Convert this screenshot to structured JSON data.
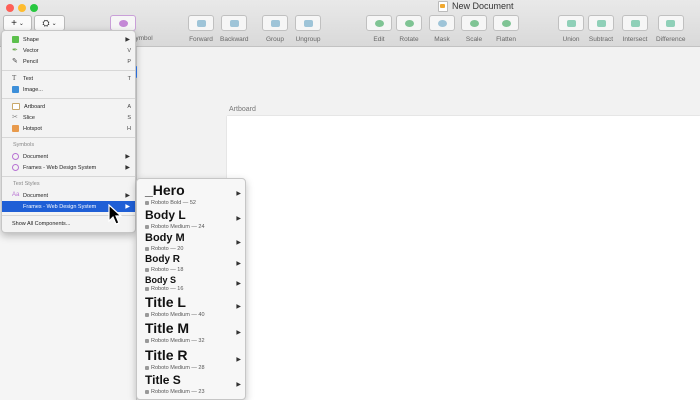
{
  "window": {
    "title": "New Document"
  },
  "toolbar": {
    "add_glyph": "+",
    "symbol_label": "Symbol",
    "tools": [
      {
        "label": "Forward"
      },
      {
        "label": "Backward"
      },
      {
        "label": "Group"
      },
      {
        "label": "Ungroup"
      },
      {
        "label": "Edit"
      },
      {
        "label": "Rotate"
      },
      {
        "label": "Mask"
      },
      {
        "label": "Scale"
      },
      {
        "label": "Flatten"
      },
      {
        "label": "Union"
      },
      {
        "label": "Subtract"
      },
      {
        "label": "Intersect"
      },
      {
        "label": "Difference"
      }
    ]
  },
  "canvas": {
    "artboard_label": "Artboard"
  },
  "insert_menu": {
    "items": [
      {
        "label": "Shape",
        "shortcut": "",
        "submenu": true,
        "icon": "shape-icon",
        "color": "#5cc04c"
      },
      {
        "label": "Vector",
        "shortcut": "V",
        "submenu": false,
        "icon": "vector-pen-icon",
        "color": "#6aa84f"
      },
      {
        "label": "Pencil",
        "shortcut": "P",
        "submenu": false,
        "icon": "pencil-icon",
        "color": "#444444"
      },
      {
        "label": "Text",
        "shortcut": "T",
        "submenu": false,
        "icon": "text-icon",
        "color": "#555555"
      },
      {
        "label": "Image...",
        "shortcut": "",
        "submenu": false,
        "icon": "image-icon",
        "color": "#3d8fd9"
      },
      {
        "label": "Artboard",
        "shortcut": "A",
        "submenu": false,
        "icon": "artboard-icon",
        "color": "#c9a86a"
      },
      {
        "label": "Slice",
        "shortcut": "S",
        "submenu": false,
        "icon": "slice-icon",
        "color": "#888888"
      },
      {
        "label": "Hotspot",
        "shortcut": "H",
        "submenu": false,
        "icon": "hotspot-icon",
        "color": "#e89a4c"
      }
    ],
    "symbols_header": "Symbols",
    "symbols": [
      {
        "label": "Document",
        "submenu": true
      },
      {
        "label": "Frames - Web Design System",
        "submenu": true
      }
    ],
    "text_styles_header": "Text Styles",
    "text_styles": [
      {
        "label": "Document",
        "submenu": true
      },
      {
        "label": "Frames - Web Design System",
        "submenu": true
      }
    ],
    "show_all": "Show All Components..."
  },
  "text_styles_submenu": [
    {
      "name": "_Hero",
      "spec": "Roboto Bold — 52"
    },
    {
      "name": "Body L",
      "spec": "Roboto Medium — 24"
    },
    {
      "name": "Body M",
      "spec": "Roboto — 20"
    },
    {
      "name": "Body R",
      "spec": "Roboto — 18"
    },
    {
      "name": "Body S",
      "spec": "Roboto — 16"
    },
    {
      "name": "Title L",
      "spec": "Roboto Medium — 40"
    },
    {
      "name": "Title M",
      "spec": "Roboto Medium — 32"
    },
    {
      "name": "Title R",
      "spec": "Roboto Medium — 28"
    },
    {
      "name": "Title S",
      "spec": "Roboto Medium — 23"
    }
  ],
  "colors": {
    "highlight": "#1f5fd6",
    "accent_tab": "#2f7bf5"
  }
}
